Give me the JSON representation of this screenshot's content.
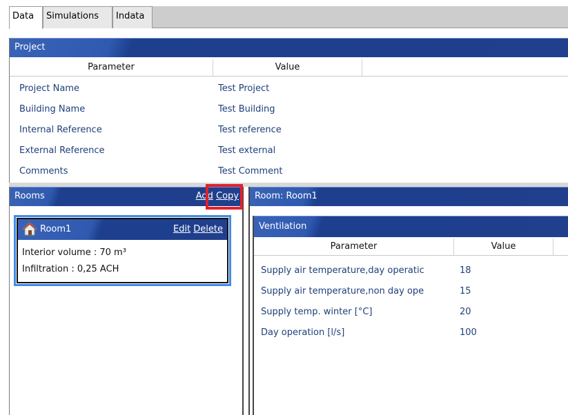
{
  "tabs": [
    {
      "label": "Data",
      "active": true
    },
    {
      "label": "Simulations",
      "active": false
    },
    {
      "label": "Indata",
      "active": false
    }
  ],
  "project": {
    "title": "Project",
    "columns": [
      "Parameter",
      "Value"
    ],
    "rows": [
      {
        "parameter": "Project Name",
        "value": "Test Project"
      },
      {
        "parameter": "Building Name",
        "value": "Test Building"
      },
      {
        "parameter": "Internal Reference",
        "value": "Test reference"
      },
      {
        "parameter": "External Reference",
        "value": "Test external"
      },
      {
        "parameter": "Comments",
        "value": "Test Comment"
      }
    ]
  },
  "rooms": {
    "title": "Rooms",
    "add_label": "Add",
    "copy_label": "Copy",
    "card": {
      "name": "Room1",
      "icon": "house-icon",
      "edit_label": "Edit",
      "delete_label": "Delete",
      "interior_volume": "Interior volume : 70 m³",
      "infiltration": "Infiltration : 0,25 ACH"
    }
  },
  "room_detail": {
    "title": "Room: Room1",
    "ventilation": {
      "title": "Ventilation",
      "columns": [
        "Parameter",
        "Value"
      ],
      "rows": [
        {
          "parameter": "Supply air temperature,day operatic",
          "value": "18"
        },
        {
          "parameter": "Supply air temperature,non day ope",
          "value": "15"
        },
        {
          "parameter": "Supply temp. winter [°C]",
          "value": "20"
        },
        {
          "parameter": "Day operation [l/s]",
          "value": "100"
        }
      ]
    }
  },
  "colors": {
    "header_blue": "#203f8d",
    "link_text": "#1e3f7a",
    "selection_border": "#3f8be6",
    "highlight_red": "#e2202a"
  }
}
